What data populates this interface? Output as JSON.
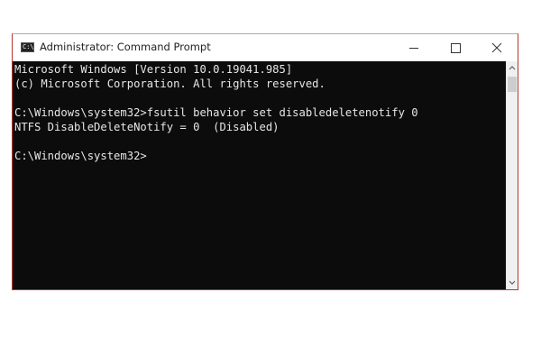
{
  "window": {
    "title": "Administrator: Command Prompt",
    "icon": "cmd-icon",
    "controls": {
      "minimize_icon": "minimize-icon",
      "maximize_icon": "maximize-icon",
      "close_icon": "close-icon"
    }
  },
  "console": {
    "lines": [
      "Microsoft Windows [Version 10.0.19041.985]",
      "(c) Microsoft Corporation. All rights reserved.",
      "",
      "C:\\Windows\\system32>fsutil behavior set disabledeletenotify 0",
      "NTFS DisableDeleteNotify = 0  (Disabled)",
      "",
      "C:\\Windows\\system32>"
    ],
    "background": "#0c0c0c",
    "foreground": "#e6e6e6"
  },
  "scrollbar": {
    "up_icon": "scroll-up-arrow-icon",
    "down_icon": "scroll-down-arrow-icon"
  }
}
